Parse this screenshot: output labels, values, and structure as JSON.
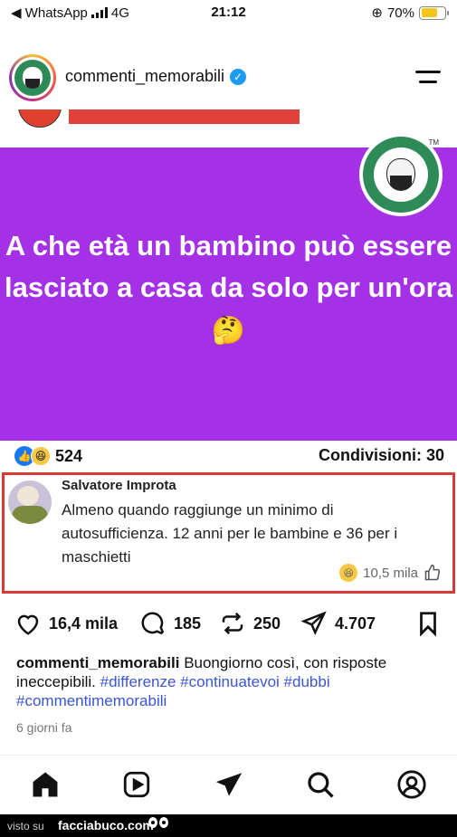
{
  "status_bar": {
    "back_app": "◀ WhatsApp",
    "network": "4G",
    "time": "21:12",
    "battery_pct": "70%",
    "battery_level": 0.7
  },
  "header": {
    "account": "commenti_memorabili"
  },
  "post": {
    "badge_tm": "TM",
    "question": "A che età un bambino può essere lasciato a casa da solo per un'ora",
    "question_emoji": "🤔",
    "reactions_count": "524",
    "shares": "Condivisioni: 30",
    "comment": {
      "author": "Salvatore Improta",
      "text": "Almeno quando raggiunge un minimo di autosufficienza. 12 anni per le bambine e 36 per i maschietti",
      "likes": "10,5 mila"
    }
  },
  "actions": {
    "likes": "16,4 mila",
    "comments": "185",
    "reposts": "250",
    "shares": "4.707"
  },
  "caption": {
    "user": "commenti_memorabili",
    "text": "Buongiorno così, con risposte ineccepibili.",
    "hashtags": [
      "#differenze",
      "#continuatevoi",
      "#dubbi",
      "#commentimemorabili"
    ],
    "time_ago": "6 giorni fa"
  },
  "footer": {
    "label": "visto su",
    "site": "facciabuco.com"
  },
  "colors": {
    "purple": "#a431e6",
    "highlight_border": "#d83a35",
    "hashtag": "#3b56d4",
    "verified": "#1d9bf0"
  }
}
